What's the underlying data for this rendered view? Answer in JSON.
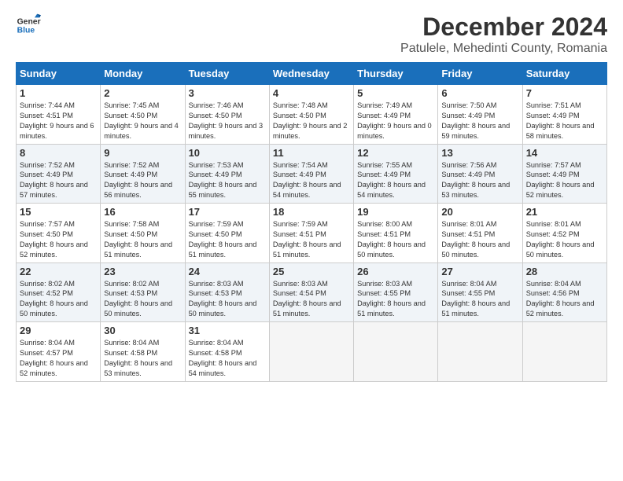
{
  "logo": {
    "line1": "General",
    "line2": "Blue"
  },
  "title": "December 2024",
  "subtitle": "Patulele, Mehedinti County, Romania",
  "headers": [
    "Sunday",
    "Monday",
    "Tuesday",
    "Wednesday",
    "Thursday",
    "Friday",
    "Saturday"
  ],
  "weeks": [
    [
      {
        "day": "1",
        "sunrise": "Sunrise: 7:44 AM",
        "sunset": "Sunset: 4:51 PM",
        "daylight": "Daylight: 9 hours and 6 minutes."
      },
      {
        "day": "2",
        "sunrise": "Sunrise: 7:45 AM",
        "sunset": "Sunset: 4:50 PM",
        "daylight": "Daylight: 9 hours and 4 minutes."
      },
      {
        "day": "3",
        "sunrise": "Sunrise: 7:46 AM",
        "sunset": "Sunset: 4:50 PM",
        "daylight": "Daylight: 9 hours and 3 minutes."
      },
      {
        "day": "4",
        "sunrise": "Sunrise: 7:48 AM",
        "sunset": "Sunset: 4:50 PM",
        "daylight": "Daylight: 9 hours and 2 minutes."
      },
      {
        "day": "5",
        "sunrise": "Sunrise: 7:49 AM",
        "sunset": "Sunset: 4:49 PM",
        "daylight": "Daylight: 9 hours and 0 minutes."
      },
      {
        "day": "6",
        "sunrise": "Sunrise: 7:50 AM",
        "sunset": "Sunset: 4:49 PM",
        "daylight": "Daylight: 8 hours and 59 minutes."
      },
      {
        "day": "7",
        "sunrise": "Sunrise: 7:51 AM",
        "sunset": "Sunset: 4:49 PM",
        "daylight": "Daylight: 8 hours and 58 minutes."
      }
    ],
    [
      {
        "day": "8",
        "sunrise": "Sunrise: 7:52 AM",
        "sunset": "Sunset: 4:49 PM",
        "daylight": "Daylight: 8 hours and 57 minutes."
      },
      {
        "day": "9",
        "sunrise": "Sunrise: 7:52 AM",
        "sunset": "Sunset: 4:49 PM",
        "daylight": "Daylight: 8 hours and 56 minutes."
      },
      {
        "day": "10",
        "sunrise": "Sunrise: 7:53 AM",
        "sunset": "Sunset: 4:49 PM",
        "daylight": "Daylight: 8 hours and 55 minutes."
      },
      {
        "day": "11",
        "sunrise": "Sunrise: 7:54 AM",
        "sunset": "Sunset: 4:49 PM",
        "daylight": "Daylight: 8 hours and 54 minutes."
      },
      {
        "day": "12",
        "sunrise": "Sunrise: 7:55 AM",
        "sunset": "Sunset: 4:49 PM",
        "daylight": "Daylight: 8 hours and 54 minutes."
      },
      {
        "day": "13",
        "sunrise": "Sunrise: 7:56 AM",
        "sunset": "Sunset: 4:49 PM",
        "daylight": "Daylight: 8 hours and 53 minutes."
      },
      {
        "day": "14",
        "sunrise": "Sunrise: 7:57 AM",
        "sunset": "Sunset: 4:49 PM",
        "daylight": "Daylight: 8 hours and 52 minutes."
      }
    ],
    [
      {
        "day": "15",
        "sunrise": "Sunrise: 7:57 AM",
        "sunset": "Sunset: 4:50 PM",
        "daylight": "Daylight: 8 hours and 52 minutes."
      },
      {
        "day": "16",
        "sunrise": "Sunrise: 7:58 AM",
        "sunset": "Sunset: 4:50 PM",
        "daylight": "Daylight: 8 hours and 51 minutes."
      },
      {
        "day": "17",
        "sunrise": "Sunrise: 7:59 AM",
        "sunset": "Sunset: 4:50 PM",
        "daylight": "Daylight: 8 hours and 51 minutes."
      },
      {
        "day": "18",
        "sunrise": "Sunrise: 7:59 AM",
        "sunset": "Sunset: 4:51 PM",
        "daylight": "Daylight: 8 hours and 51 minutes."
      },
      {
        "day": "19",
        "sunrise": "Sunrise: 8:00 AM",
        "sunset": "Sunset: 4:51 PM",
        "daylight": "Daylight: 8 hours and 50 minutes."
      },
      {
        "day": "20",
        "sunrise": "Sunrise: 8:01 AM",
        "sunset": "Sunset: 4:51 PM",
        "daylight": "Daylight: 8 hours and 50 minutes."
      },
      {
        "day": "21",
        "sunrise": "Sunrise: 8:01 AM",
        "sunset": "Sunset: 4:52 PM",
        "daylight": "Daylight: 8 hours and 50 minutes."
      }
    ],
    [
      {
        "day": "22",
        "sunrise": "Sunrise: 8:02 AM",
        "sunset": "Sunset: 4:52 PM",
        "daylight": "Daylight: 8 hours and 50 minutes."
      },
      {
        "day": "23",
        "sunrise": "Sunrise: 8:02 AM",
        "sunset": "Sunset: 4:53 PM",
        "daylight": "Daylight: 8 hours and 50 minutes."
      },
      {
        "day": "24",
        "sunrise": "Sunrise: 8:03 AM",
        "sunset": "Sunset: 4:53 PM",
        "daylight": "Daylight: 8 hours and 50 minutes."
      },
      {
        "day": "25",
        "sunrise": "Sunrise: 8:03 AM",
        "sunset": "Sunset: 4:54 PM",
        "daylight": "Daylight: 8 hours and 51 minutes."
      },
      {
        "day": "26",
        "sunrise": "Sunrise: 8:03 AM",
        "sunset": "Sunset: 4:55 PM",
        "daylight": "Daylight: 8 hours and 51 minutes."
      },
      {
        "day": "27",
        "sunrise": "Sunrise: 8:04 AM",
        "sunset": "Sunset: 4:55 PM",
        "daylight": "Daylight: 8 hours and 51 minutes."
      },
      {
        "day": "28",
        "sunrise": "Sunrise: 8:04 AM",
        "sunset": "Sunset: 4:56 PM",
        "daylight": "Daylight: 8 hours and 52 minutes."
      }
    ],
    [
      {
        "day": "29",
        "sunrise": "Sunrise: 8:04 AM",
        "sunset": "Sunset: 4:57 PM",
        "daylight": "Daylight: 8 hours and 52 minutes."
      },
      {
        "day": "30",
        "sunrise": "Sunrise: 8:04 AM",
        "sunset": "Sunset: 4:58 PM",
        "daylight": "Daylight: 8 hours and 53 minutes."
      },
      {
        "day": "31",
        "sunrise": "Sunrise: 8:04 AM",
        "sunset": "Sunset: 4:58 PM",
        "daylight": "Daylight: 8 hours and 54 minutes."
      },
      null,
      null,
      null,
      null
    ]
  ]
}
